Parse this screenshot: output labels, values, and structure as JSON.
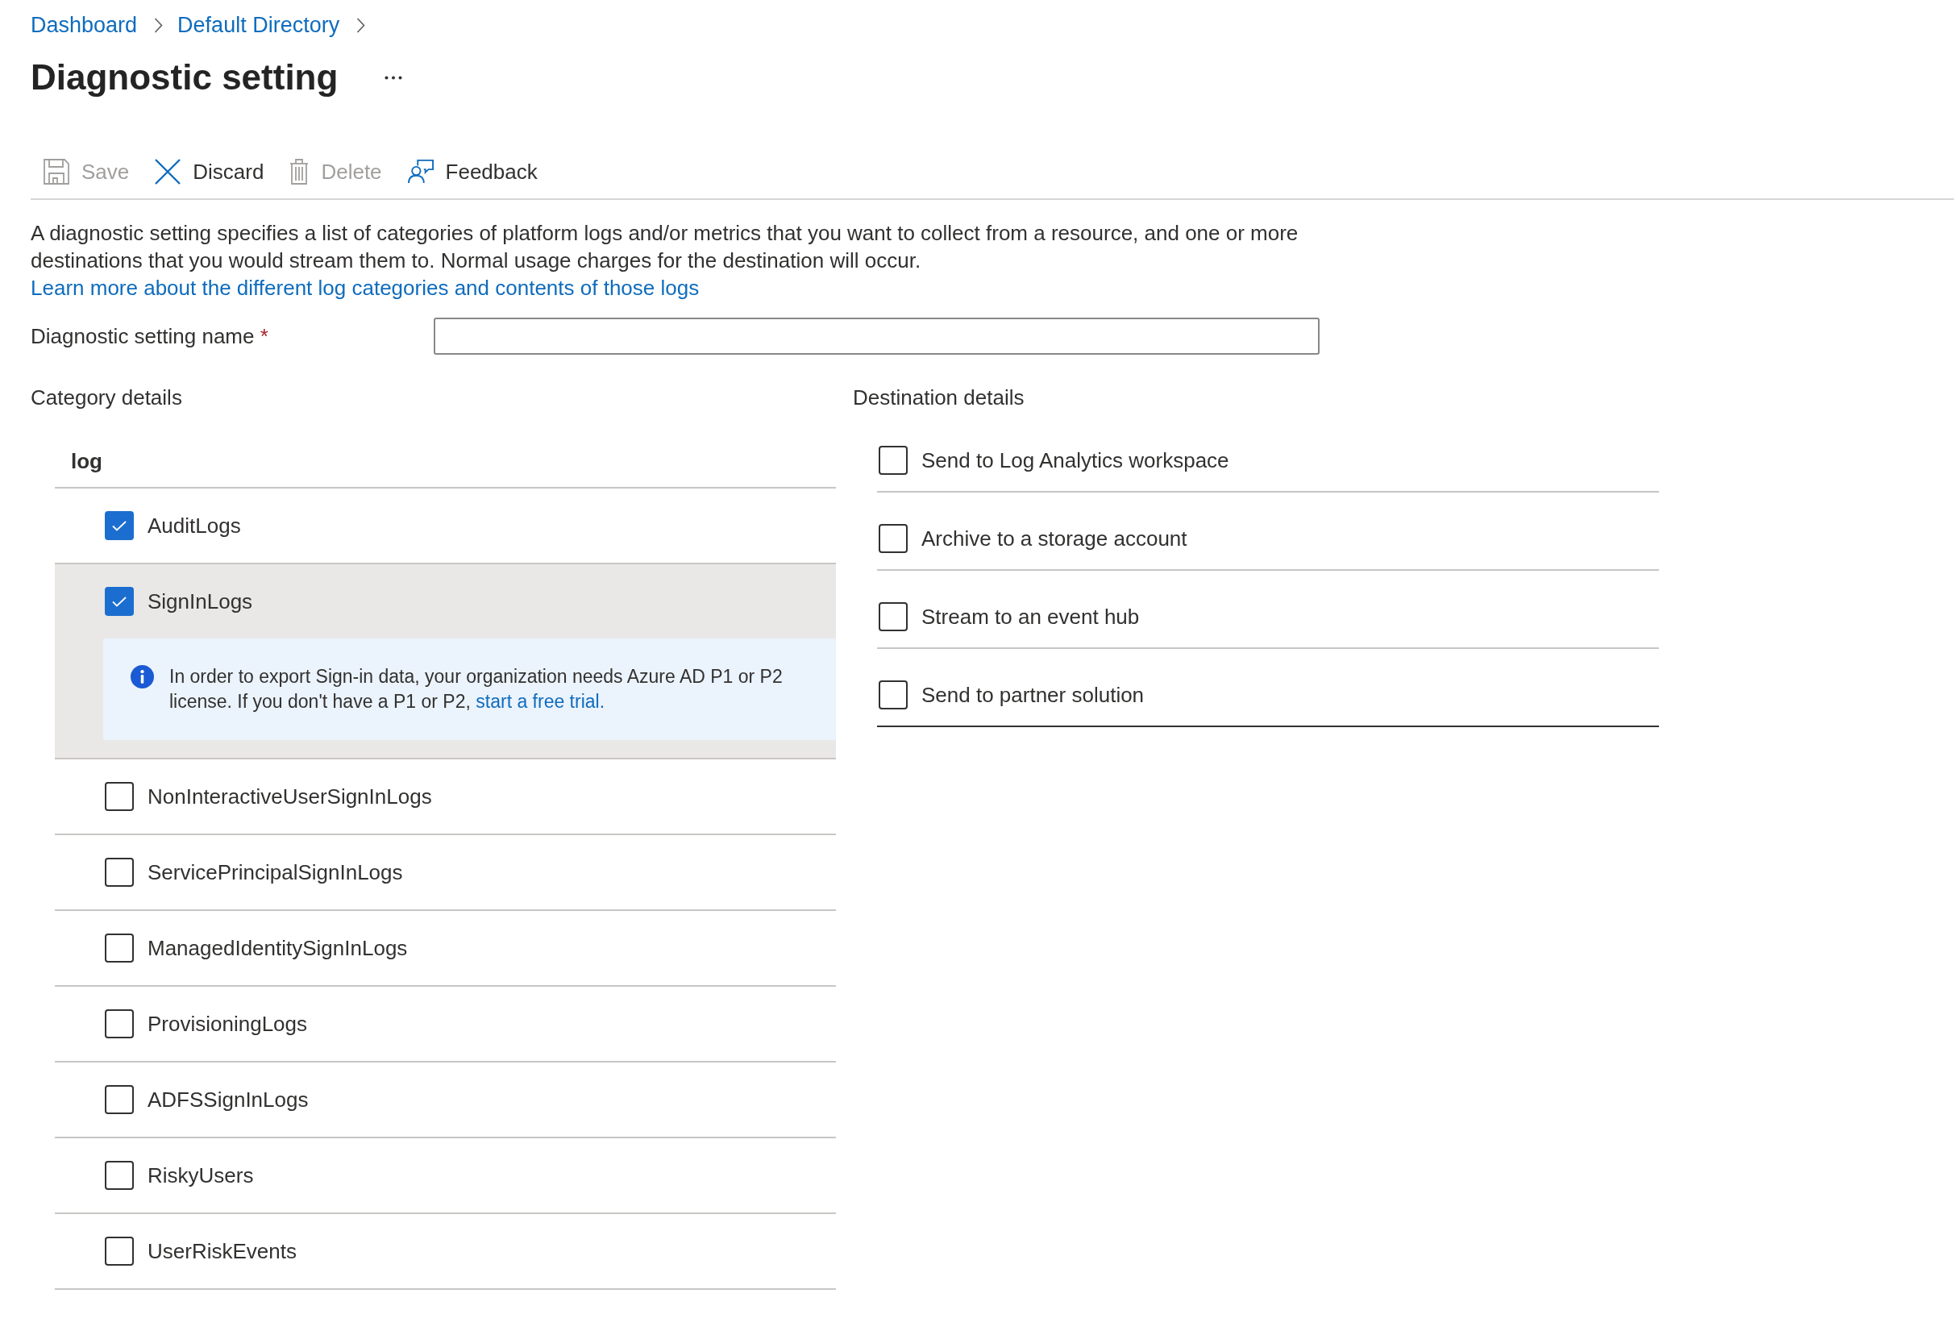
{
  "breadcrumb": [
    {
      "label": "Dashboard"
    },
    {
      "label": "Default Directory"
    }
  ],
  "title": "Diagnostic setting",
  "toolbar": [
    {
      "kind": "save",
      "label": "Save",
      "disabled": true
    },
    {
      "kind": "discard",
      "label": "Discard",
      "disabled": false
    },
    {
      "kind": "delete",
      "label": "Delete",
      "disabled": true
    },
    {
      "kind": "feedback",
      "label": "Feedback",
      "disabled": false
    }
  ],
  "description": {
    "text": "A diagnostic setting specifies a list of categories of platform logs and/or metrics that you want to collect from a resource, and one or more destinations that you would stream them to. Normal usage charges for the destination will occur.",
    "link": "Learn more about the different log categories and contents of those logs"
  },
  "name_field": {
    "label": "Diagnostic setting name",
    "required_mark": "*"
  },
  "category_details": {
    "heading": "Category details",
    "group": "log",
    "items": [
      {
        "label": "AuditLogs",
        "checked": true,
        "selected": false
      },
      {
        "label": "SignInLogs",
        "checked": true,
        "selected": true,
        "notice": {
          "text": "In order to export Sign-in data, your organization needs Azure AD P1 or P2 license. If you don't have a P1 or P2,",
          "link": "start a free trial."
        }
      },
      {
        "label": "NonInteractiveUserSignInLogs",
        "checked": false,
        "selected": false
      },
      {
        "label": "ServicePrincipalSignInLogs",
        "checked": false,
        "selected": false
      },
      {
        "label": "ManagedIdentitySignInLogs",
        "checked": false,
        "selected": false
      },
      {
        "label": "ProvisioningLogs",
        "checked": false,
        "selected": false
      },
      {
        "label": "ADFSSignInLogs",
        "checked": false,
        "selected": false
      },
      {
        "label": "RiskyUsers",
        "checked": false,
        "selected": false
      },
      {
        "label": "UserRiskEvents",
        "checked": false,
        "selected": false
      }
    ]
  },
  "destination_details": {
    "heading": "Destination details",
    "items": [
      {
        "label": "Send to Log Analytics workspace",
        "checked": false
      },
      {
        "label": "Archive to a storage account",
        "checked": false
      },
      {
        "label": "Stream to an event hub",
        "checked": false
      },
      {
        "label": "Send to partner solution",
        "checked": false
      }
    ]
  }
}
